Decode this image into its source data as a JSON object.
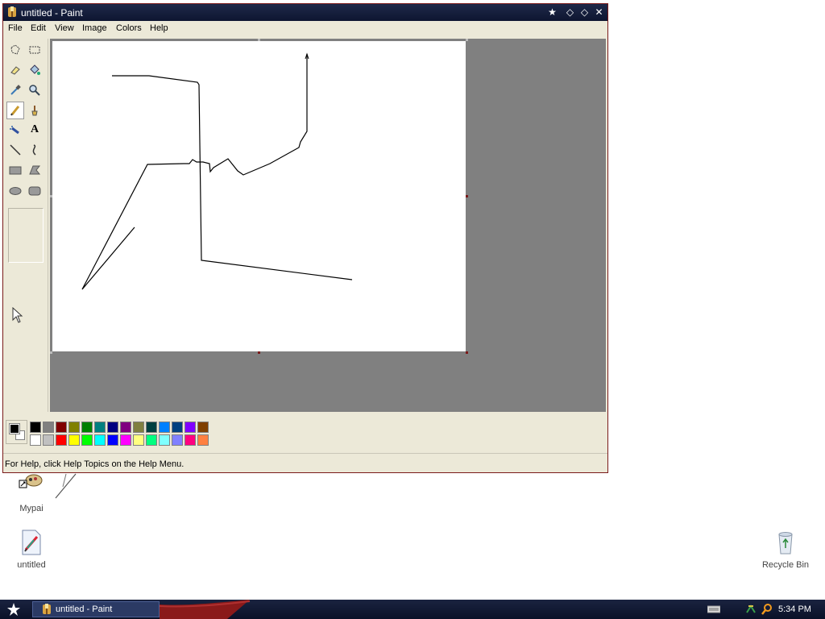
{
  "window": {
    "title": "untitled - Paint",
    "controls": [
      "★",
      "◇",
      "◇",
      "✕"
    ]
  },
  "menu": [
    "File",
    "Edit",
    "View",
    "Image",
    "Colors",
    "Help"
  ],
  "tools": [
    {
      "name": "free-form-select-icon",
      "glyph": ""
    },
    {
      "name": "select-icon",
      "glyph": ""
    },
    {
      "name": "eraser-icon",
      "glyph": ""
    },
    {
      "name": "fill-bucket-icon",
      "glyph": ""
    },
    {
      "name": "color-picker-icon",
      "glyph": ""
    },
    {
      "name": "magnifier-icon",
      "glyph": ""
    },
    {
      "name": "pencil-icon",
      "glyph": ""
    },
    {
      "name": "brush-icon",
      "glyph": ""
    },
    {
      "name": "airbrush-icon",
      "glyph": ""
    },
    {
      "name": "text-icon",
      "glyph": "A"
    },
    {
      "name": "line-icon",
      "glyph": ""
    },
    {
      "name": "curve-icon",
      "glyph": ""
    },
    {
      "name": "rectangle-icon",
      "glyph": ""
    },
    {
      "name": "polygon-icon",
      "glyph": ""
    },
    {
      "name": "ellipse-icon",
      "glyph": ""
    },
    {
      "name": "rounded-rectangle-icon",
      "glyph": ""
    }
  ],
  "palette": {
    "current_foreground": "#000000",
    "current_background": "#ffffff",
    "row1": [
      "#000000",
      "#808080",
      "#800000",
      "#808000",
      "#008000",
      "#008080",
      "#000080",
      "#800080",
      "#808040",
      "#004040",
      "#0080ff",
      "#004080",
      "#8000ff",
      "#804000"
    ],
    "row2": [
      "#ffffff",
      "#c0c0c0",
      "#ff0000",
      "#ffff00",
      "#00ff00",
      "#00ffff",
      "#0000ff",
      "#ff00ff",
      "#ffff80",
      "#00ff80",
      "#80ffff",
      "#8080ff",
      "#ff0080",
      "#ff8040"
    ]
  },
  "status": "For Help, click Help Topics on the Help Menu.",
  "desktop_icons": [
    {
      "label": "Mypai"
    },
    {
      "label": "untitled"
    },
    {
      "label": "Recycle Bin"
    }
  ],
  "taskbar": {
    "task_label": "untitled - Paint",
    "clock": "5:34 PM"
  }
}
